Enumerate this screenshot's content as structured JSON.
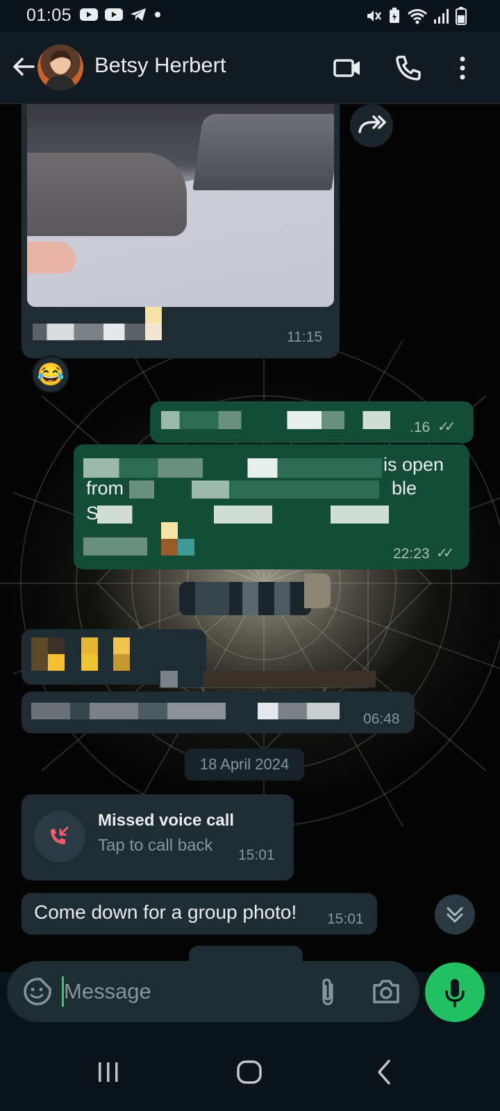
{
  "status_bar": {
    "time": "01:05",
    "left_icons": [
      "youtube-icon",
      "youtube-icon",
      "telegram-icon",
      "dot-icon"
    ],
    "right_icons": [
      "mute-icon",
      "battery-saver-icon",
      "wifi-icon",
      "signal-icon",
      "battery-icon"
    ]
  },
  "header": {
    "contact_name": "Betsy Herbert",
    "actions": [
      "video-call-icon",
      "voice-call-icon",
      "more-options-icon"
    ]
  },
  "messages": {
    "photo_message": {
      "time": "11:15",
      "reaction": "😂"
    },
    "outgoing_1": {
      "time": ".16",
      "status": "✓✓"
    },
    "outgoing_2": {
      "line1_visible": "is open",
      "line2_start": "from",
      "line2_end": "ble",
      "line3_start": "S",
      "time": "22:23",
      "status": "✓✓"
    },
    "incoming_3": {
      "time": "06:48"
    },
    "date_divider": "18 April 2024",
    "missed_call": {
      "title": "Missed voice call",
      "subtitle": "Tap to call back",
      "time": "15:01"
    },
    "last_message": {
      "text": "Come down for a group photo!",
      "time": "15:01"
    }
  },
  "composer": {
    "placeholder": "Message"
  },
  "colors": {
    "accent_green": "#21c063",
    "outgoing_bubble": "#144d37",
    "incoming_bubble": "#202c33",
    "missed_call_red": "#f15c6d"
  }
}
